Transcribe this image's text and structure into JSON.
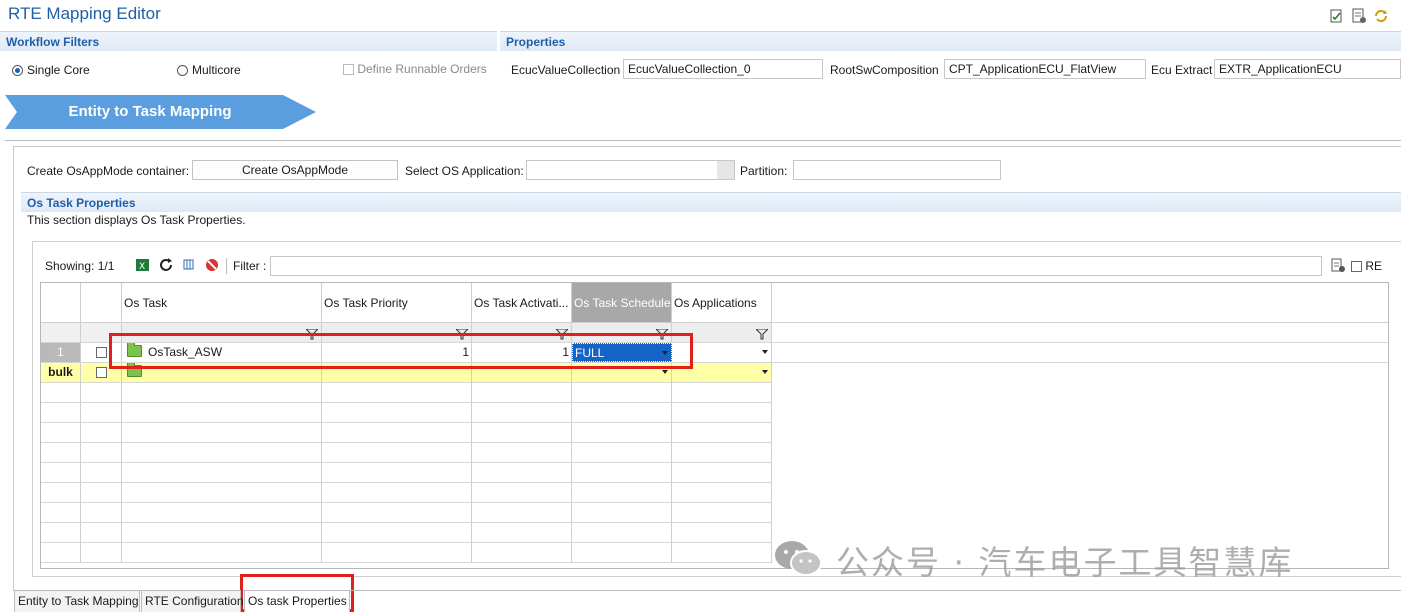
{
  "window": {
    "title": "RTE Mapping Editor"
  },
  "workflow": {
    "header": "Workflow Filters",
    "single_core": "Single Core",
    "multicore": "Multicore",
    "define_runnable": "Define Runnable Orders"
  },
  "properties": {
    "header": "Properties",
    "ecuc_label": "EcucValueCollection",
    "ecuc_value": "EcucValueCollection_0",
    "root_label": "RootSwComposition",
    "root_value": "CPT_ApplicationECU_FlatView",
    "extract_label": "Ecu Extract",
    "extract_value": "EXTR_ApplicationECU"
  },
  "banner": {
    "label": "Entity to Task Mapping"
  },
  "toolbar": {
    "osappmode_label": "Create OsAppMode container:",
    "osappmode_button": "Create OsAppMode",
    "select_os_label": "Select OS Application:",
    "select_os_value": "",
    "partition_label": "Partition:",
    "partition_value": ""
  },
  "section": {
    "header": "Os Task Properties",
    "description": "This section displays Os Task Properties."
  },
  "grid_toolbar": {
    "showing": "Showing: 1/1",
    "filter_label": "Filter :",
    "filter_value": "",
    "re_label": "RE"
  },
  "table": {
    "columns": [
      "Os Task",
      "Os Task Priority",
      "Os Task Activati...",
      "Os Task Schedule",
      "Os Applications"
    ],
    "rows": [
      {
        "num": "1",
        "task": "OsTask_ASW",
        "priority": "1",
        "activation": "1",
        "schedule": "FULL",
        "applications": ""
      }
    ],
    "bulk": {
      "num": "bulk"
    }
  },
  "tabs": [
    "Entity to Task Mapping",
    "RTE Configuration",
    "Os task Properties"
  ],
  "watermark": "公众号 · 汽车电子工具智慧库",
  "colors": {
    "accent": "#1f5fa8",
    "banner": "#4a90d9",
    "highlight": "#e0201b",
    "bulk_row": "#ffffa8",
    "selected_cell": "#1464c8"
  }
}
